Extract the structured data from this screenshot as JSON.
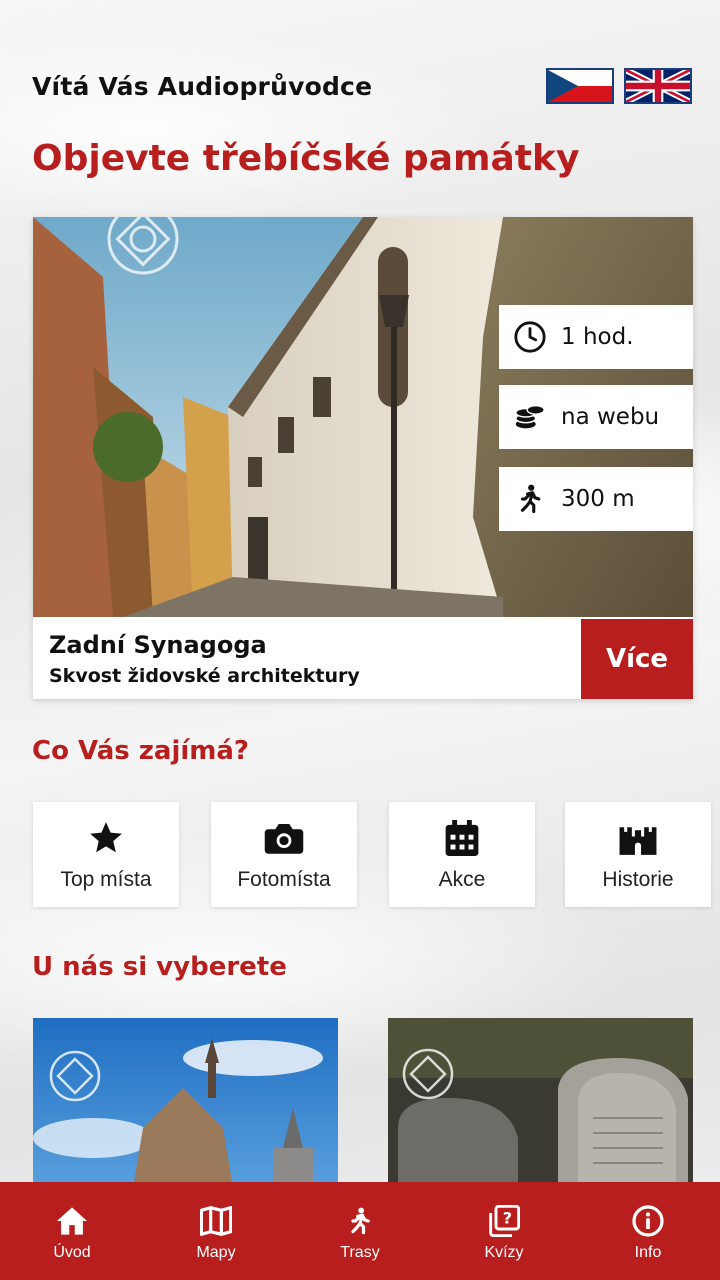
{
  "header": {
    "welcome": "Vítá Vás Audioprůvodce",
    "languages": [
      {
        "code": "cs",
        "icon": "czech-flag-icon"
      },
      {
        "code": "en",
        "icon": "uk-flag-icon"
      }
    ]
  },
  "main_title": "Objevte třebíčské památky",
  "featured": {
    "name": "Zadní Synagoga",
    "subtitle": "Skvost židovské architektury",
    "more_label": "Více",
    "info": [
      {
        "icon": "clock-icon",
        "text": "1 hod."
      },
      {
        "icon": "coins-icon",
        "text": "na webu"
      },
      {
        "icon": "walking-person-icon",
        "text": "300 m"
      }
    ]
  },
  "interests": {
    "title": "Co Vás zajímá?",
    "items": [
      {
        "icon": "star-icon",
        "label": "Top místa"
      },
      {
        "icon": "camera-icon",
        "label": "Fotomísta"
      },
      {
        "icon": "calendar-icon",
        "label": "Akce"
      },
      {
        "icon": "castle-icon",
        "label": "Historie"
      }
    ]
  },
  "picks": {
    "title": "U nás si vyberete"
  },
  "tabbar": {
    "items": [
      {
        "icon": "home-icon",
        "label": "Úvod"
      },
      {
        "icon": "map-icon",
        "label": "Mapy"
      },
      {
        "icon": "walking-icon",
        "label": "Trasy"
      },
      {
        "icon": "quiz-icon",
        "label": "Kvízy"
      },
      {
        "icon": "info-icon",
        "label": "Info"
      }
    ]
  },
  "colors": {
    "accent": "#b81e1e",
    "text": "#111111",
    "card": "#ffffff"
  }
}
